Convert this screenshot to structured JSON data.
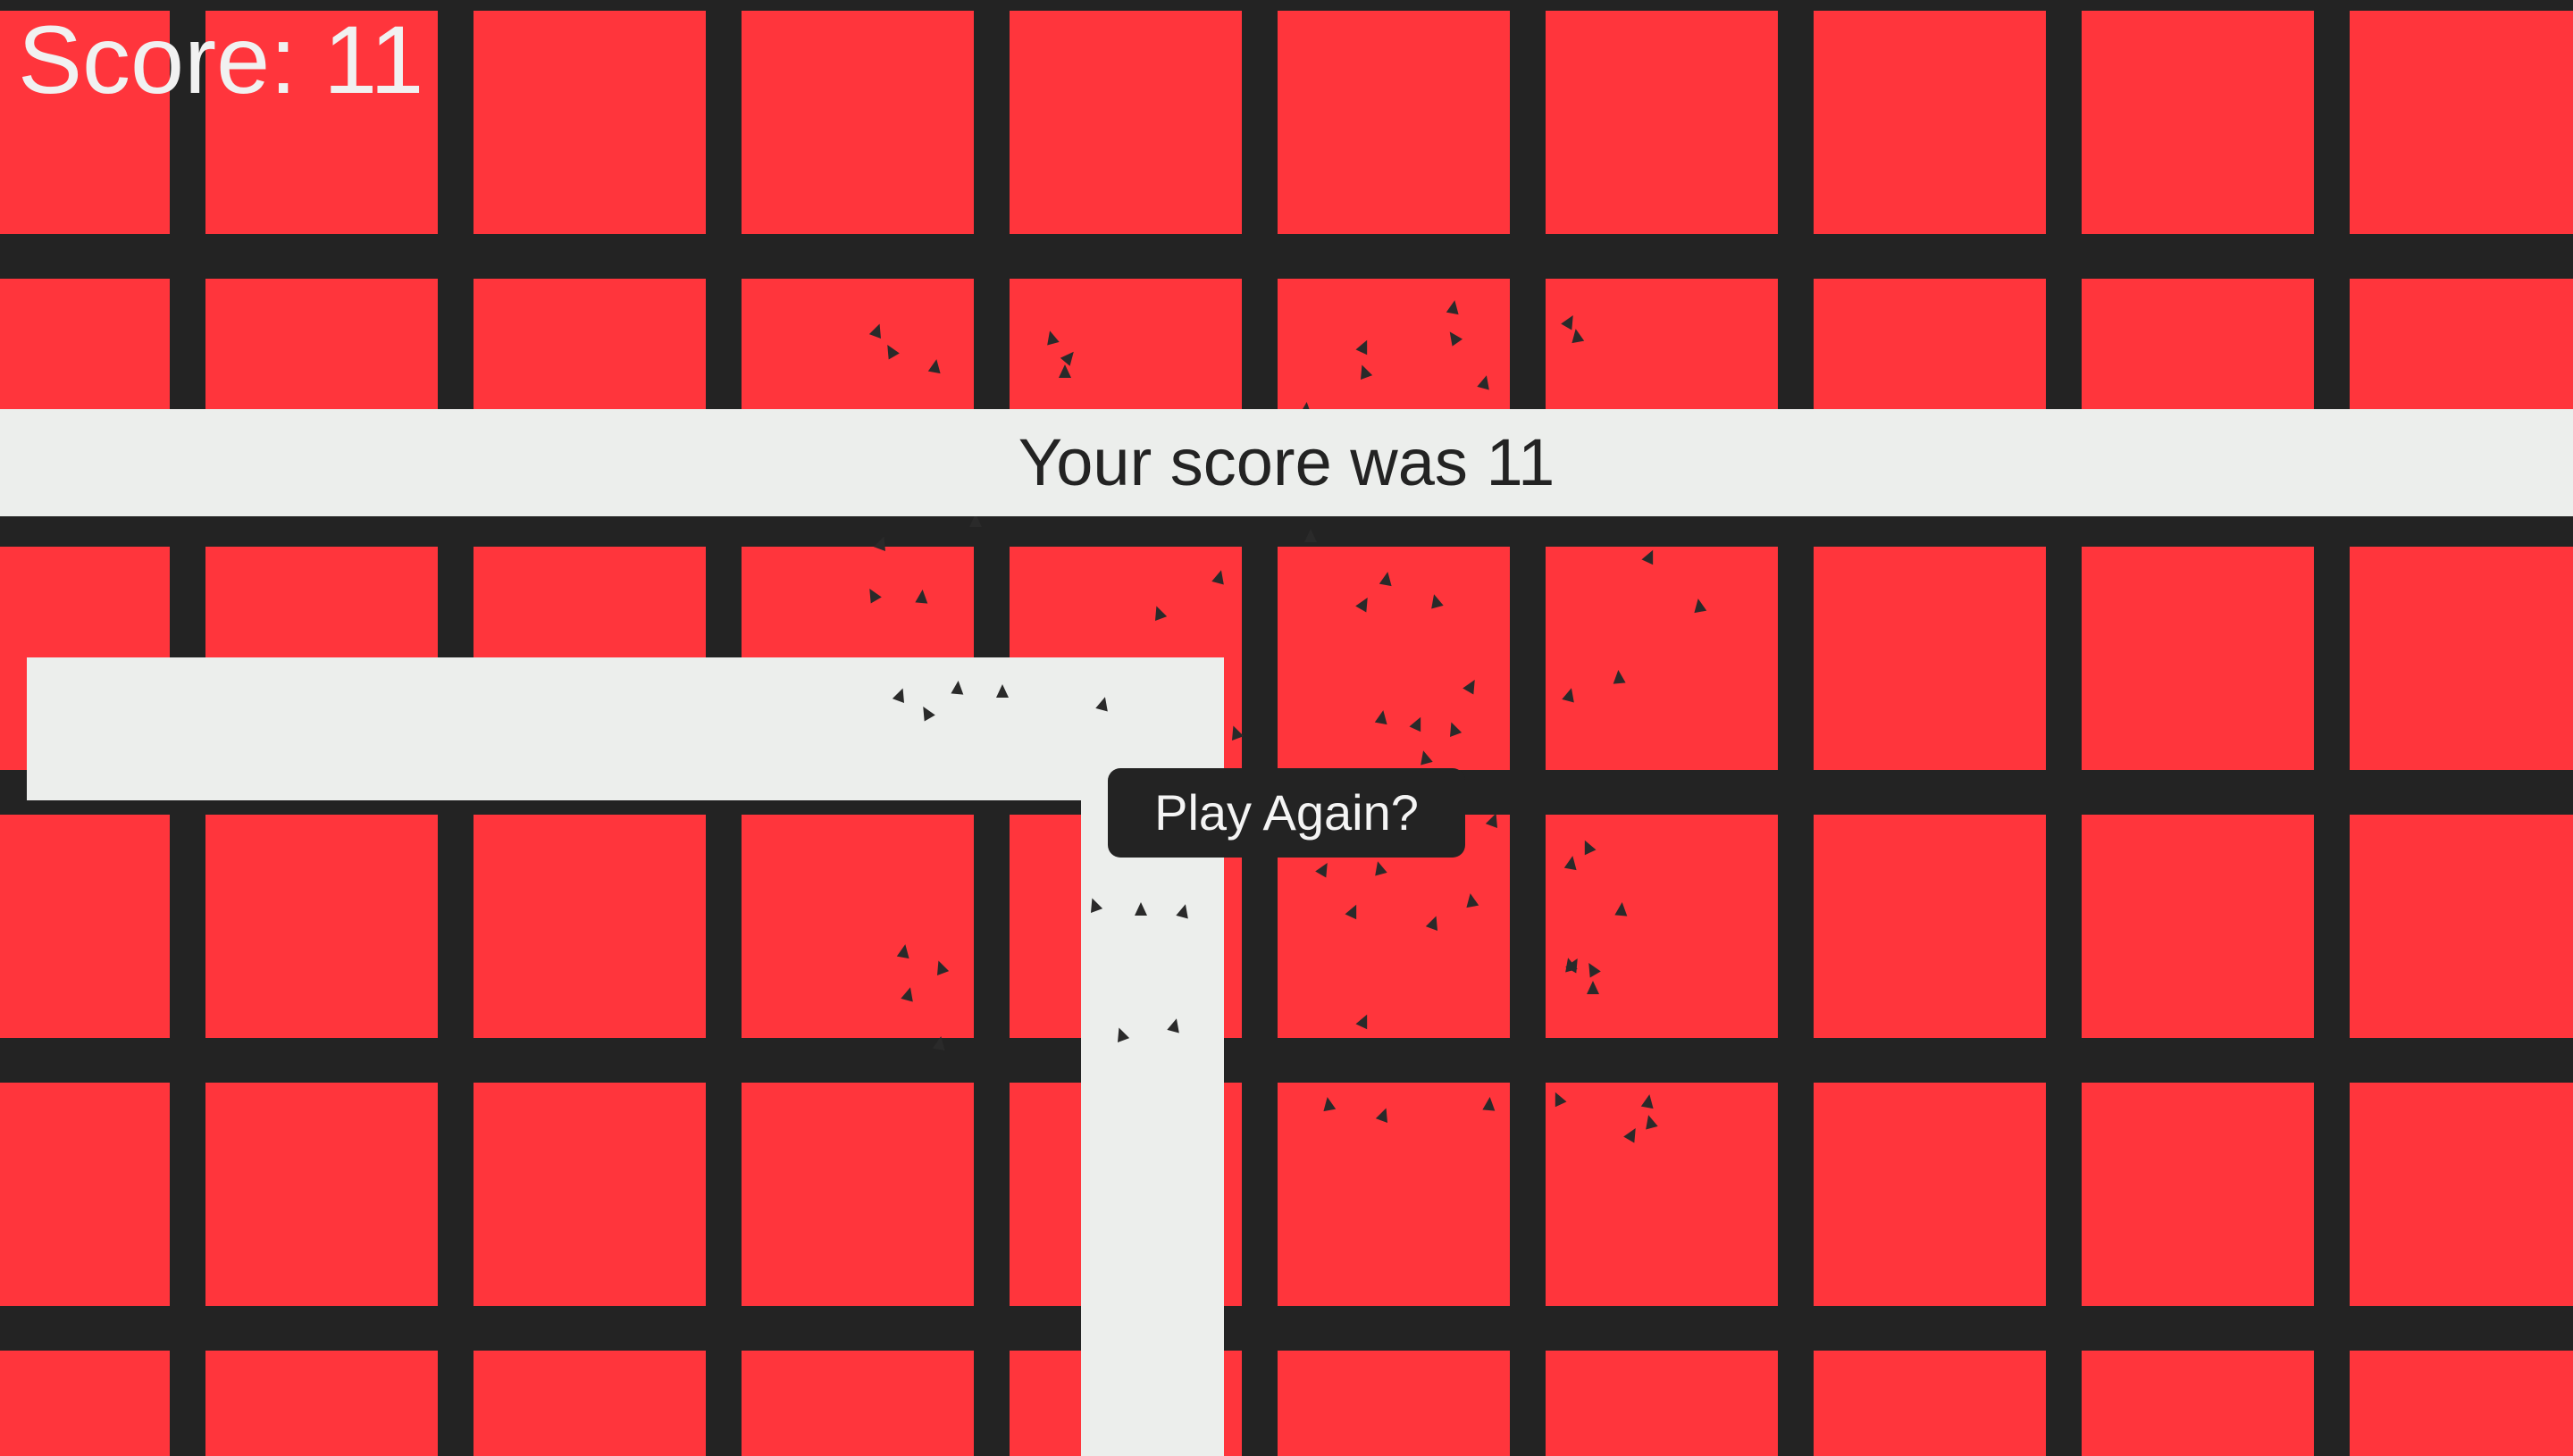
{
  "hud": {
    "score_label": "Score: 11"
  },
  "game_over": {
    "result_text": "Your score was 11",
    "play_again_label": "Play Again?"
  },
  "colors": {
    "tile": "#ff353c",
    "grid_line": "#232323",
    "path": "#eceeec",
    "debris": "#2a2a2a"
  }
}
